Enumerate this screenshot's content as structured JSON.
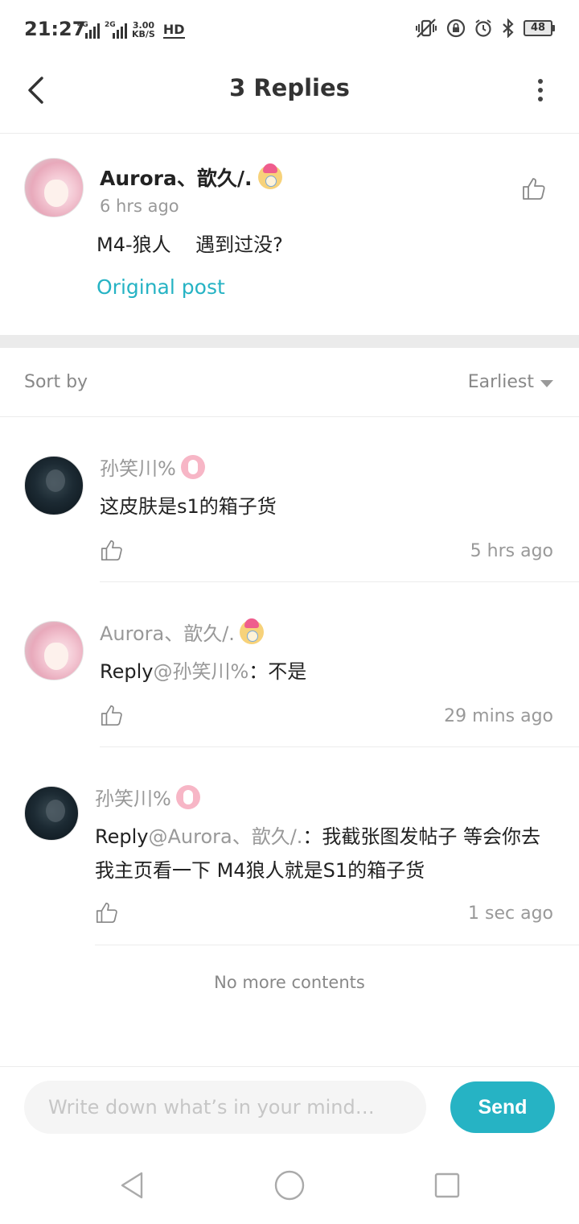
{
  "status_bar": {
    "time": "21:27",
    "sim1_label": "4G",
    "sim2_label": "2G",
    "speed_value": "3.00",
    "speed_unit": "KB/S",
    "hd_label": "HD",
    "battery_level": "48"
  },
  "header": {
    "title": "3 Replies"
  },
  "original": {
    "author": "Aurora、歆久/.",
    "time": "6 hrs ago",
    "text": "M4-狼人    遇到过没?",
    "link_label": "Original post"
  },
  "sort": {
    "label": "Sort by",
    "selected": "Earliest"
  },
  "replies": [
    {
      "author": "孙笑川%",
      "text": "这皮肤是s1的箱子货",
      "time": "5 hrs ago"
    },
    {
      "author": "Aurora、歆久/.",
      "reply_prefix": "Reply",
      "reply_to": "@孙笑川%",
      "text": "：不是",
      "time": "29 mins ago"
    },
    {
      "author": "孙笑川%",
      "reply_prefix": "Reply",
      "reply_to": "@Aurora、歆久/.",
      "text": "：我截张图发帖子 等会你去我主页看一下 M4狼人就是S1的箱子货",
      "time": "1 sec ago"
    }
  ],
  "footer_note": "No more contents",
  "composer": {
    "placeholder": "Write down what’s in your mind…",
    "send_label": "Send"
  },
  "colors": {
    "accent": "#26b3c4",
    "muted_text": "#999999",
    "divider": "#ececec"
  },
  "icons": {
    "back": "chevron-left-icon",
    "more": "more-vertical-icon",
    "like": "thumbs-up-icon",
    "sort": "caret-down-icon",
    "nav_back": "triangle-back-icon",
    "nav_home": "circle-home-icon",
    "nav_recent": "square-recent-icon"
  }
}
